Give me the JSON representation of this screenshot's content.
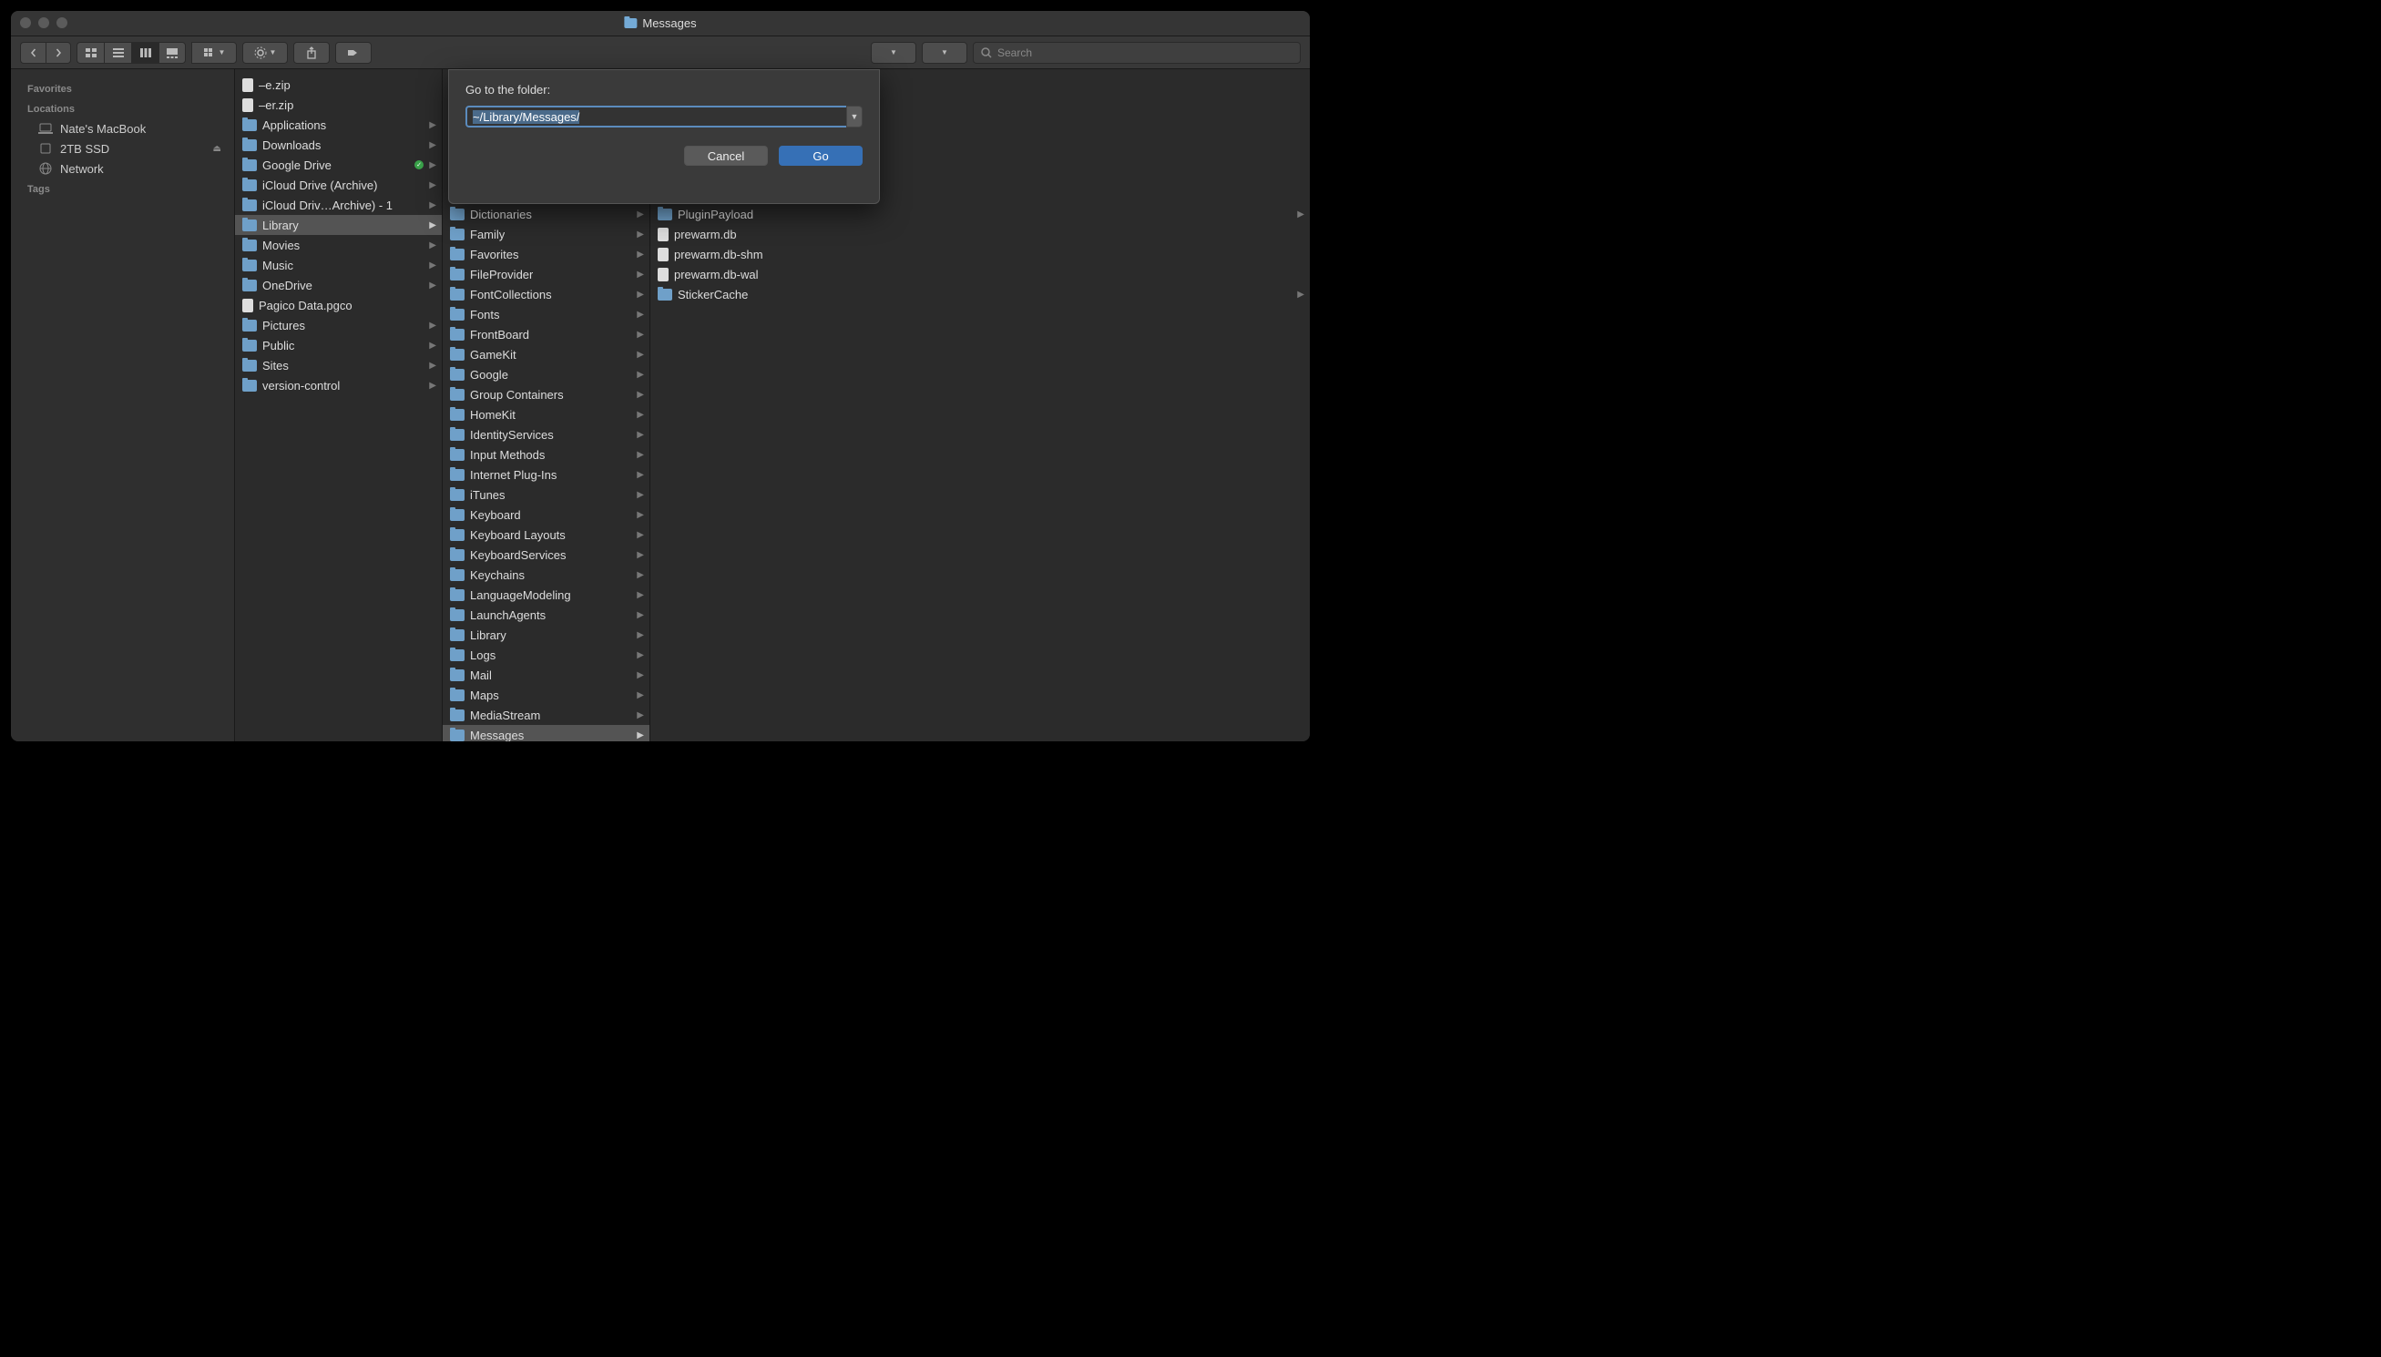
{
  "window": {
    "title": "Messages"
  },
  "toolbar": {
    "search_placeholder": "Search"
  },
  "sidebar": {
    "sections": [
      {
        "label": "Favorites",
        "items": []
      },
      {
        "label": "Locations",
        "items": [
          {
            "label": "Nate's MacBook",
            "icon": "laptop",
            "eject": false
          },
          {
            "label": "2TB SSD",
            "icon": "disk",
            "eject": true
          },
          {
            "label": "Network",
            "icon": "globe",
            "eject": false
          }
        ]
      },
      {
        "label": "Tags",
        "items": []
      }
    ]
  },
  "column1": {
    "selected": "Library",
    "items": [
      {
        "label": "–e.zip",
        "type": "file",
        "arrow": false
      },
      {
        "label": "–er.zip",
        "type": "file",
        "arrow": false
      },
      {
        "label": "Applications",
        "type": "folder",
        "arrow": true
      },
      {
        "label": "Downloads",
        "type": "folder",
        "arrow": true
      },
      {
        "label": "Google Drive",
        "type": "folder",
        "arrow": true,
        "check": true
      },
      {
        "label": "iCloud Drive (Archive)",
        "type": "folder",
        "arrow": true
      },
      {
        "label": "iCloud Driv…Archive) - 1",
        "type": "folder",
        "arrow": true
      },
      {
        "label": "Library",
        "type": "folder",
        "arrow": true,
        "selected": true
      },
      {
        "label": "Movies",
        "type": "folder",
        "arrow": true
      },
      {
        "label": "Music",
        "type": "folder",
        "arrow": true
      },
      {
        "label": "OneDrive",
        "type": "folder",
        "arrow": true
      },
      {
        "label": "Pagico Data.pgco",
        "type": "file",
        "arrow": false
      },
      {
        "label": "Pictures",
        "type": "folder",
        "arrow": true
      },
      {
        "label": "Public",
        "type": "folder",
        "arrow": true
      },
      {
        "label": "Sites",
        "type": "folder",
        "arrow": true
      },
      {
        "label": "version-control",
        "type": "folder",
        "arrow": true
      }
    ]
  },
  "column2": {
    "selected": "Messages",
    "items": [
      {
        "label": "Dictionaries",
        "type": "folder",
        "arrow": true
      },
      {
        "label": "Family",
        "type": "folder",
        "arrow": true
      },
      {
        "label": "Favorites",
        "type": "folder",
        "arrow": true
      },
      {
        "label": "FileProvider",
        "type": "folder",
        "arrow": true
      },
      {
        "label": "FontCollections",
        "type": "folder",
        "arrow": true
      },
      {
        "label": "Fonts",
        "type": "folder",
        "arrow": true
      },
      {
        "label": "FrontBoard",
        "type": "folder",
        "arrow": true
      },
      {
        "label": "GameKit",
        "type": "folder",
        "arrow": true
      },
      {
        "label": "Google",
        "type": "folder",
        "arrow": true
      },
      {
        "label": "Group Containers",
        "type": "folder",
        "arrow": true
      },
      {
        "label": "HomeKit",
        "type": "folder",
        "arrow": true
      },
      {
        "label": "IdentityServices",
        "type": "folder",
        "arrow": true
      },
      {
        "label": "Input Methods",
        "type": "folder",
        "arrow": true
      },
      {
        "label": "Internet Plug-Ins",
        "type": "folder",
        "arrow": true
      },
      {
        "label": "iTunes",
        "type": "folder",
        "arrow": true
      },
      {
        "label": "Keyboard",
        "type": "folder",
        "arrow": true
      },
      {
        "label": "Keyboard Layouts",
        "type": "folder",
        "arrow": true
      },
      {
        "label": "KeyboardServices",
        "type": "folder",
        "arrow": true
      },
      {
        "label": "Keychains",
        "type": "folder",
        "arrow": true
      },
      {
        "label": "LanguageModeling",
        "type": "folder",
        "arrow": true
      },
      {
        "label": "LaunchAgents",
        "type": "folder",
        "arrow": true
      },
      {
        "label": "Library",
        "type": "folder",
        "arrow": true
      },
      {
        "label": "Logs",
        "type": "folder",
        "arrow": true
      },
      {
        "label": "Mail",
        "type": "folder",
        "arrow": true
      },
      {
        "label": "Maps",
        "type": "folder",
        "arrow": true
      },
      {
        "label": "MediaStream",
        "type": "folder",
        "arrow": true
      },
      {
        "label": "Messages",
        "type": "folder",
        "arrow": true,
        "selected": true
      }
    ]
  },
  "column3": {
    "items": [
      {
        "label": "PluginPayload",
        "type": "folder",
        "arrow": true
      },
      {
        "label": "prewarm.db",
        "type": "file",
        "arrow": false
      },
      {
        "label": "prewarm.db-shm",
        "type": "file",
        "arrow": false
      },
      {
        "label": "prewarm.db-wal",
        "type": "file",
        "arrow": false
      },
      {
        "label": "StickerCache",
        "type": "folder",
        "arrow": true
      }
    ]
  },
  "sheet": {
    "label": "Go to the folder:",
    "value": "~/Library/Messages/",
    "cancel": "Cancel",
    "go": "Go"
  }
}
